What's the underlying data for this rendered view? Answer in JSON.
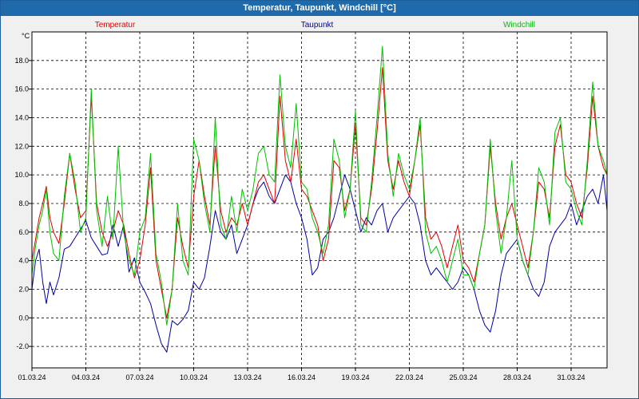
{
  "window": {
    "title": "Temperatur, Taupunkt, Windchill [°C]",
    "subtitle": ""
  },
  "chart_data": {
    "type": "line",
    "title": "Temperatur, Taupunkt, Windchill [°C]",
    "ylabel": "°C",
    "xlabel": "",
    "ylim": [
      -3.5,
      20.0
    ],
    "xlim": [
      1.0,
      33.0
    ],
    "grid": true,
    "legend_position": "top",
    "y_ticks": [
      -2.0,
      0.0,
      2.0,
      4.0,
      6.0,
      8.0,
      10.0,
      12.0,
      14.0,
      16.0,
      18.0
    ],
    "y_tick_labels": [
      "-2.0",
      "0.0",
      "2.0",
      "4.0",
      "6.0",
      "8.0",
      "10.0",
      "12.0",
      "14.0",
      "16.0",
      "18.0"
    ],
    "x_ticks": [
      1,
      4,
      7,
      10,
      13,
      16,
      19,
      22,
      25,
      28,
      31
    ],
    "x_tick_labels": [
      "01.03.24",
      "04.03.24",
      "07.03.24",
      "10.03.24",
      "13.03.24",
      "16.03.24",
      "19.03.24",
      "22.03.24",
      "25.03.24",
      "28.03.24",
      "31.03.24"
    ],
    "series": [
      {
        "name": "Taupunkt",
        "color": "#0000a0",
        "x": [
          1.0,
          1.2,
          1.4,
          1.6,
          1.8,
          2.0,
          2.2,
          2.5,
          2.8,
          3.1,
          3.4,
          3.7,
          4.0,
          4.3,
          4.6,
          4.9,
          5.2,
          5.5,
          5.8,
          6.1,
          6.4,
          6.7,
          7.0,
          7.3,
          7.6,
          7.9,
          8.2,
          8.5,
          8.8,
          9.1,
          9.4,
          9.7,
          10.0,
          10.3,
          10.6,
          10.9,
          11.2,
          11.5,
          11.8,
          12.1,
          12.4,
          12.7,
          13.0,
          13.3,
          13.6,
          13.9,
          14.2,
          14.5,
          14.8,
          15.1,
          15.4,
          15.7,
          16.0,
          16.3,
          16.6,
          16.9,
          17.2,
          17.5,
          17.8,
          18.1,
          18.4,
          18.7,
          19.0,
          19.3,
          19.6,
          19.9,
          20.2,
          20.5,
          20.8,
          21.1,
          21.4,
          21.7,
          22.0,
          22.3,
          22.6,
          22.9,
          23.2,
          23.5,
          23.8,
          24.1,
          24.4,
          24.7,
          25.0,
          25.3,
          25.6,
          25.9,
          26.2,
          26.5,
          26.8,
          27.1,
          27.4,
          27.7,
          28.0,
          28.3,
          28.6,
          28.9,
          29.2,
          29.5,
          29.8,
          30.1,
          30.4,
          30.7,
          31.0,
          31.3,
          31.6,
          31.9,
          32.2,
          32.5,
          32.8,
          33.0
        ],
        "values": [
          2.0,
          4.0,
          4.8,
          2.5,
          1.0,
          2.5,
          1.6,
          2.8,
          4.8,
          5.0,
          5.6,
          6.2,
          6.8,
          5.6,
          5.0,
          4.4,
          4.5,
          6.5,
          5.0,
          6.5,
          3.2,
          4.2,
          2.5,
          1.8,
          1.0,
          -0.5,
          -1.8,
          -2.4,
          -0.2,
          -0.5,
          -0.1,
          0.5,
          2.5,
          2.0,
          2.8,
          5.0,
          7.5,
          6.0,
          5.5,
          6.5,
          4.5,
          5.5,
          6.5,
          8.0,
          9.0,
          9.5,
          8.5,
          8.0,
          9.0,
          10.0,
          9.5,
          8.0,
          7.0,
          5.5,
          3.0,
          3.5,
          5.5,
          6.0,
          7.0,
          8.5,
          10.0,
          9.0,
          7.5,
          6.0,
          7.0,
          6.5,
          7.5,
          8.0,
          6.0,
          7.0,
          7.5,
          8.0,
          8.5,
          8.0,
          6.5,
          4.0,
          3.0,
          3.5,
          3.0,
          2.5,
          2.0,
          2.5,
          3.5,
          3.0,
          2.0,
          0.5,
          -0.5,
          -1.0,
          0.5,
          3.0,
          4.5,
          5.0,
          5.5,
          4.0,
          3.0,
          2.0,
          1.5,
          2.5,
          5.0,
          6.0,
          6.5,
          7.0,
          8.0,
          6.5,
          7.5,
          8.5,
          9.0,
          8.0,
          10.0,
          7.5
        ]
      },
      {
        "name": "Temperatur",
        "color": "#e00000",
        "x": [
          1.0,
          1.2,
          1.4,
          1.6,
          1.8,
          2.0,
          2.2,
          2.5,
          2.8,
          3.1,
          3.4,
          3.7,
          4.0,
          4.3,
          4.6,
          4.9,
          5.2,
          5.5,
          5.8,
          6.1,
          6.4,
          6.7,
          7.0,
          7.3,
          7.6,
          7.9,
          8.2,
          8.5,
          8.8,
          9.1,
          9.4,
          9.7,
          10.0,
          10.3,
          10.6,
          10.9,
          11.2,
          11.5,
          11.8,
          12.1,
          12.4,
          12.7,
          13.0,
          13.3,
          13.6,
          13.9,
          14.2,
          14.5,
          14.8,
          15.1,
          15.4,
          15.7,
          16.0,
          16.3,
          16.6,
          16.9,
          17.2,
          17.5,
          17.8,
          18.1,
          18.4,
          18.7,
          19.0,
          19.3,
          19.6,
          19.9,
          20.2,
          20.5,
          20.8,
          21.1,
          21.4,
          21.7,
          22.0,
          22.3,
          22.6,
          22.9,
          23.2,
          23.5,
          23.8,
          24.1,
          24.4,
          24.7,
          25.0,
          25.3,
          25.6,
          25.9,
          26.2,
          26.5,
          26.8,
          27.1,
          27.4,
          27.7,
          28.0,
          28.3,
          28.6,
          28.9,
          29.2,
          29.5,
          29.8,
          30.1,
          30.4,
          30.7,
          31.0,
          31.3,
          31.6,
          31.9,
          32.2,
          32.5,
          32.8,
          33.0
        ],
        "values": [
          4.0,
          5.5,
          7.0,
          8.0,
          9.2,
          7.0,
          6.0,
          5.2,
          8.0,
          11.5,
          9.0,
          7.0,
          7.5,
          15.5,
          8.0,
          6.0,
          5.0,
          6.0,
          7.5,
          6.5,
          4.5,
          2.8,
          4.0,
          6.5,
          10.5,
          4.0,
          2.0,
          0.0,
          2.0,
          7.0,
          5.0,
          3.5,
          8.5,
          11.0,
          8.5,
          6.5,
          12.0,
          7.5,
          6.0,
          7.0,
          6.5,
          8.0,
          6.5,
          8.0,
          9.5,
          10.0,
          9.0,
          8.0,
          15.5,
          11.0,
          9.5,
          12.5,
          9.0,
          8.5,
          7.5,
          6.5,
          4.0,
          5.5,
          11.0,
          10.5,
          7.5,
          9.0,
          13.5,
          7.0,
          6.5,
          9.0,
          13.0,
          17.5,
          11.0,
          9.0,
          11.0,
          9.5,
          8.5,
          11.0,
          13.5,
          7.0,
          5.5,
          6.0,
          5.0,
          3.5,
          5.0,
          6.5,
          4.0,
          3.5,
          2.5,
          4.5,
          6.5,
          12.0,
          8.0,
          5.5,
          7.0,
          8.0,
          6.5,
          5.0,
          3.5,
          6.0,
          9.5,
          9.0,
          7.0,
          12.0,
          13.5,
          10.0,
          9.5,
          8.0,
          7.0,
          10.5,
          15.5,
          12.0,
          10.5,
          10.0
        ]
      },
      {
        "name": "Windchill",
        "color": "#00c000",
        "x": [
          1.0,
          1.2,
          1.4,
          1.6,
          1.8,
          2.0,
          2.2,
          2.5,
          2.8,
          3.1,
          3.4,
          3.7,
          4.0,
          4.3,
          4.6,
          4.9,
          5.2,
          5.5,
          5.8,
          6.1,
          6.4,
          6.7,
          7.0,
          7.3,
          7.6,
          7.9,
          8.2,
          8.5,
          8.8,
          9.1,
          9.4,
          9.7,
          10.0,
          10.3,
          10.6,
          10.9,
          11.2,
          11.5,
          11.8,
          12.1,
          12.4,
          12.7,
          13.0,
          13.3,
          13.6,
          13.9,
          14.2,
          14.5,
          14.8,
          15.1,
          15.4,
          15.7,
          16.0,
          16.3,
          16.6,
          16.9,
          17.2,
          17.5,
          17.8,
          18.1,
          18.4,
          18.7,
          19.0,
          19.3,
          19.6,
          19.9,
          20.2,
          20.5,
          20.8,
          21.1,
          21.4,
          21.7,
          22.0,
          22.3,
          22.6,
          22.9,
          23.2,
          23.5,
          23.8,
          24.1,
          24.4,
          24.7,
          25.0,
          25.3,
          25.6,
          25.9,
          26.2,
          26.5,
          26.8,
          27.1,
          27.4,
          27.7,
          28.0,
          28.3,
          28.6,
          28.9,
          29.2,
          29.5,
          29.8,
          30.1,
          30.4,
          30.7,
          31.0,
          31.3,
          31.6,
          31.9,
          32.2,
          32.5,
          32.8,
          33.0
        ],
        "values": [
          3.0,
          5.0,
          6.5,
          7.5,
          9.0,
          6.0,
          4.5,
          4.0,
          8.5,
          11.5,
          9.5,
          6.0,
          7.0,
          16.0,
          7.5,
          5.0,
          8.5,
          5.5,
          12.0,
          6.0,
          4.0,
          3.0,
          6.0,
          7.0,
          11.5,
          4.5,
          2.5,
          -0.5,
          2.0,
          8.0,
          4.0,
          3.0,
          12.5,
          11.0,
          8.0,
          6.0,
          14.0,
          6.5,
          5.5,
          8.5,
          6.0,
          9.0,
          7.5,
          9.0,
          11.5,
          12.0,
          10.0,
          9.5,
          17.0,
          12.0,
          10.5,
          15.0,
          9.5,
          9.0,
          7.0,
          6.0,
          4.5,
          6.5,
          12.5,
          11.0,
          7.0,
          9.0,
          14.5,
          6.5,
          6.0,
          9.5,
          14.0,
          19.0,
          11.5,
          8.5,
          11.5,
          10.0,
          9.0,
          11.0,
          14.0,
          6.0,
          4.5,
          5.0,
          4.0,
          2.5,
          4.0,
          5.5,
          3.0,
          3.0,
          2.0,
          4.5,
          6.5,
          12.5,
          7.5,
          4.5,
          7.0,
          11.0,
          5.5,
          4.0,
          3.0,
          6.0,
          10.5,
          9.5,
          6.5,
          13.0,
          14.0,
          9.5,
          9.0,
          7.5,
          6.5,
          11.0,
          16.5,
          12.0,
          11.0,
          10.0
        ]
      }
    ]
  }
}
